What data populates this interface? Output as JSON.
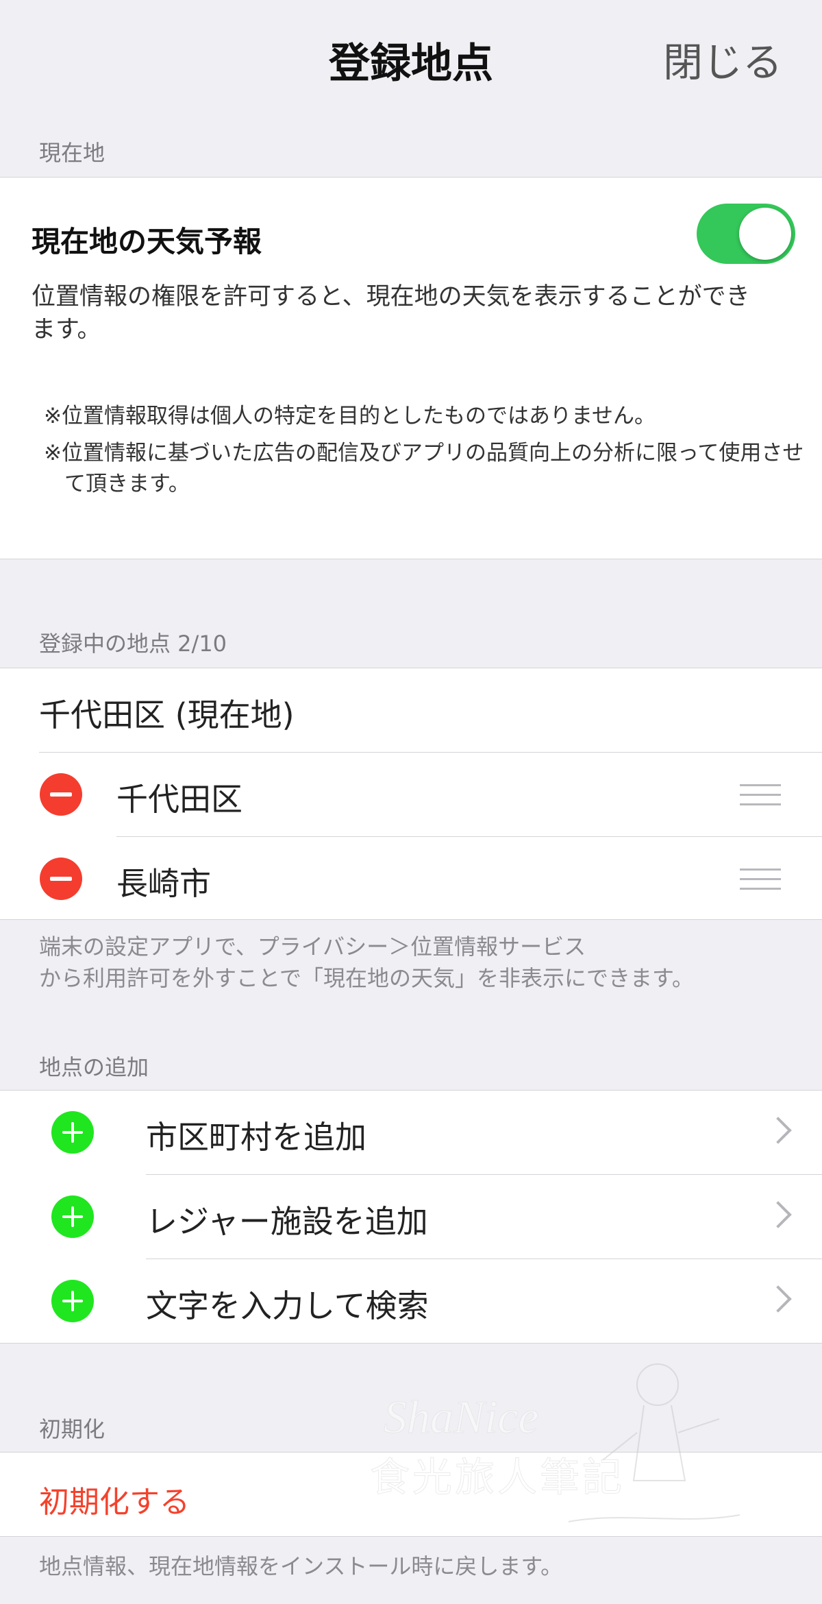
{
  "nav": {
    "title": "登録地点",
    "close_label": "閉じる"
  },
  "current_location": {
    "header": "現在地",
    "title": "現在地の天気予報",
    "toggle_on": true,
    "description": "位置情報の権限を許可すると、現在地の天気を表示することができます。",
    "notes": [
      "※位置情報取得は個人の特定を目的としたものではありません。",
      "※位置情報に基づいた広告の配信及びアプリの品質向上の分析に限って使用させて頂きます。"
    ]
  },
  "registered": {
    "header": "登録中の地点 2/10",
    "current_row": "千代田区 (現在地)",
    "items": [
      {
        "label": "千代田区"
      },
      {
        "label": "長崎市"
      }
    ],
    "footer": "端末の設定アプリで、プライバシー＞位置情報サービス\nから利用許可を外すことで「現在地の天気」を非表示にできます。"
  },
  "add": {
    "header": "地点の追加",
    "items": [
      {
        "label": "市区町村を追加"
      },
      {
        "label": "レジャー施設を追加"
      },
      {
        "label": "文字を入力して検索"
      }
    ]
  },
  "reset": {
    "header": "初期化",
    "button_label": "初期化する",
    "footer": "地点情報、現在地情報をインストール時に戻します。"
  },
  "watermark": {
    "line1": "ShaNice",
    "line2": "食光旅人筆記"
  },
  "colors": {
    "background": "#efeff4",
    "toggle_on": "#34c759",
    "delete": "#f43d2f",
    "add": "#20e620",
    "destructive_text": "#f4422c"
  }
}
